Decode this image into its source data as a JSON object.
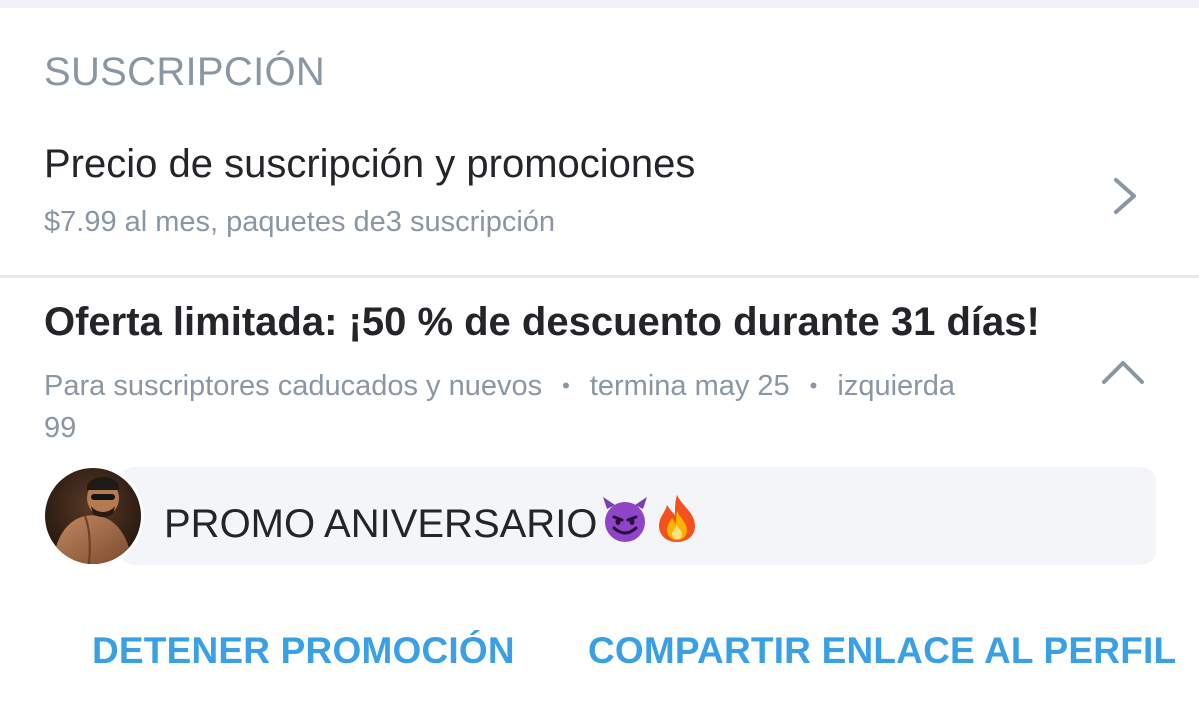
{
  "section": {
    "header": "SUSCRIPCIÓN"
  },
  "price_row": {
    "title": "Precio de suscripción y promociones",
    "subtitle": "$7.99 al mes, paquetes de3 suscripción",
    "icon": "chevron-right-icon"
  },
  "promo": {
    "title": "Oferta limitada: ¡50 % de descuento durante 31 días!",
    "audience": "Para suscriptores caducados y nuevos",
    "separator": "•",
    "ends": "termina may 25",
    "left_label": "izquierda",
    "left_count": "99",
    "collapse_icon": "chevron-up-icon"
  },
  "message": {
    "text": "PROMO ANIVERSARIO",
    "emojis": [
      "smiling-devil-emoji",
      "fire-emoji"
    ],
    "avatar": "avatar"
  },
  "actions": {
    "stop_label": "DETENER PROMOCIÓN",
    "share_label": "COMPARTIR ENLACE AL PERFIL"
  },
  "colors": {
    "accent": "#3aa0e6",
    "muted_text": "#8a96a3",
    "primary_text": "#242529",
    "bubble_bg": "#f4f5f8"
  }
}
